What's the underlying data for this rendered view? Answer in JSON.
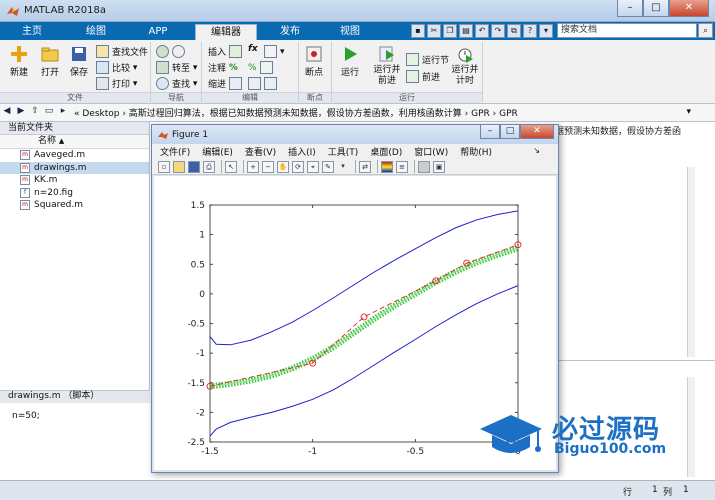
{
  "window": {
    "title": "MATLAB R2018a",
    "buttons": [
      "–",
      "□",
      "✕"
    ]
  },
  "tabs": [
    "主页",
    "绘图",
    "APP",
    "编辑器",
    "发布",
    "视图"
  ],
  "active_tab": "编辑器",
  "quick_access": {
    "search_placeholder": "搜索文档"
  },
  "ribbon": {
    "file": {
      "new": "新建",
      "open": "打开",
      "save": "保存",
      "find_files": "查找文件",
      "compare": "比较",
      "print": "打印",
      "section": "文件"
    },
    "navigate": {
      "goto": "转至",
      "find": "查找",
      "section": "导航"
    },
    "edit": {
      "insert": "插入",
      "comment": "注释",
      "indent": "缩进",
      "fx": "fx",
      "section": "编辑"
    },
    "breakpoints": {
      "label": "断点",
      "section": "断点"
    },
    "run": {
      "run": "运行",
      "run_advance": "运行并前进",
      "run_section": "运行节",
      "advance": "前进",
      "run_time": "运行并计时",
      "section": "运行"
    }
  },
  "address": {
    "path": "« Desktop › 高斯过程回归算法，根据已知数据预测未知数据，假设协方差函数，利用核函数计算 › GPR › GPR"
  },
  "current_folder": {
    "header": "当前文件夹",
    "column_name": "名称",
    "sort_indicator": "▲",
    "files": [
      {
        "name": "Aaveged.m",
        "selected": false
      },
      {
        "name": "drawings.m",
        "selected": true
      },
      {
        "name": "KK.m",
        "selected": false
      },
      {
        "name": "n=20.fig",
        "selected": false
      },
      {
        "name": "Squared.m",
        "selected": false
      }
    ]
  },
  "details": {
    "header": "drawings.m （脚本）",
    "content": "n=50;"
  },
  "command_header_text": "据预测未知数据，假设协方差函",
  "status": {
    "row_label": "行",
    "row_value": "1",
    "col_label": "列",
    "col_value": "1"
  },
  "figure": {
    "title": "Figure 1",
    "menu": [
      "文件(F)",
      "编辑(E)",
      "查看(V)",
      "插入(I)",
      "工具(T)",
      "桌面(D)",
      "窗口(W)",
      "帮助(H)"
    ],
    "toolbar_icons": [
      "new-icon",
      "open-icon",
      "save-icon",
      "print-icon",
      "pointer-icon",
      "zoom-in-icon",
      "zoom-out-icon",
      "pan-icon",
      "rotate-icon",
      "datacursor-icon",
      "brush-icon",
      "link-icon",
      "colorbar-icon",
      "legend-icon",
      "hide-plot-tools-icon",
      "show-plot-tools-icon"
    ]
  },
  "chart_data": {
    "type": "line",
    "title": "",
    "xlabel": "",
    "ylabel": "",
    "xlim": [
      -1.5,
      0
    ],
    "ylim": [
      -2.5,
      1.5
    ],
    "xticks": [
      -1.5,
      -1,
      -0.5,
      0
    ],
    "yticks": [
      -2.5,
      -2,
      -1.5,
      -1,
      -0.5,
      0,
      0.5,
      1,
      1.5
    ],
    "grid": false,
    "series": [
      {
        "style": "blue-line",
        "color": "#1f1fcf",
        "x": [
          -1.5,
          -1.47,
          -1.4,
          -1.3,
          -1.2,
          -1.1,
          -1.0,
          -0.9,
          -0.8,
          -0.7,
          -0.6,
          -0.5,
          -0.4,
          -0.3,
          -0.2,
          -0.1,
          0.0
        ],
        "y": [
          -0.72,
          -0.85,
          -0.86,
          -0.78,
          -0.64,
          -0.48,
          -0.28,
          -0.07,
          0.15,
          0.37,
          0.57,
          0.76,
          0.95,
          1.12,
          1.25,
          1.34,
          1.4
        ]
      },
      {
        "style": "blue-line",
        "color": "#1f1fcf",
        "x": [
          -1.5,
          -1.47,
          -1.4,
          -1.3,
          -1.2,
          -1.1,
          -1.0,
          -0.9,
          -0.8,
          -0.7,
          -0.6,
          -0.5,
          -0.4,
          -0.3,
          -0.2,
          -0.1,
          0.0
        ],
        "y": [
          -2.4,
          -2.28,
          -2.17,
          -2.08,
          -2.0,
          -1.9,
          -1.78,
          -1.62,
          -1.42,
          -1.2,
          -0.98,
          -0.77,
          -0.55,
          -0.35,
          -0.16,
          0.0,
          0.14
        ]
      },
      {
        "style": "green-dotted-band",
        "color": "#18c01c",
        "x": [
          -1.5,
          -1.4,
          -1.3,
          -1.2,
          -1.1,
          -1.0,
          -0.9,
          -0.8,
          -0.7,
          -0.6,
          -0.5,
          -0.4,
          -0.3,
          -0.2,
          -0.1,
          0.0
        ],
        "y": [
          -1.56,
          -1.52,
          -1.46,
          -1.38,
          -1.26,
          -1.1,
          -0.9,
          -0.66,
          -0.42,
          -0.2,
          0.0,
          0.2,
          0.38,
          0.53,
          0.66,
          0.77
        ]
      },
      {
        "style": "red-dashed-circles",
        "color": "#e0221f",
        "x": [
          -1.5,
          -1.0,
          -0.75,
          -0.4,
          -0.25,
          0.0
        ],
        "y": [
          -1.56,
          -1.17,
          -0.39,
          0.22,
          0.52,
          0.83
        ]
      }
    ]
  },
  "watermark": {
    "cn": "必过源码",
    "en": "Biguo100.com"
  }
}
